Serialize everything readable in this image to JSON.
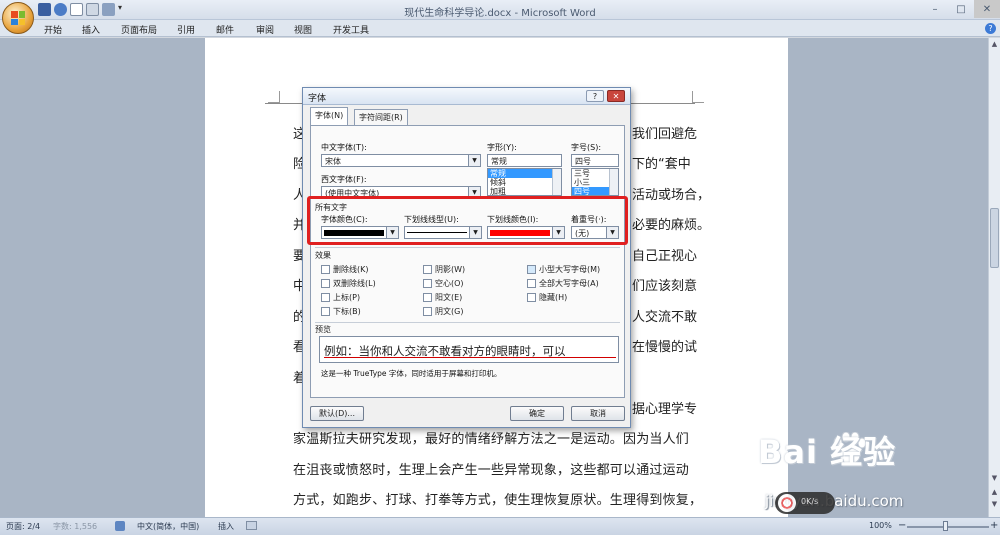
{
  "window": {
    "title": "现代生命科学导论.docx - Microsoft Word",
    "controls": [
      "–",
      "□",
      "✕"
    ]
  },
  "quick_access": {
    "items": [
      "save-icon",
      "undo-icon",
      "new-icon",
      "print-preview-icon",
      "repeat-icon"
    ],
    "customize_glyph": "▾"
  },
  "ribbon": {
    "tabs": [
      "开始",
      "插入",
      "页面布局",
      "引用",
      "邮件",
      "审阅",
      "视图",
      "开发工具"
    ],
    "help": "?"
  },
  "document": {
    "lines": [
      "这",
      "险",
      "人",
      "并",
      "要",
      "中",
      "的",
      "看",
      "着",
      "",
      "家温斯拉夫研究发现，最好的情绪纾解方法之一是运动。因为当人们",
      "在沮丧或愤怒时，生理上会产生一些异常现象，这些都可以通过运动",
      "方式，如跑步、打球、打拳等方式，使生理恢复原状。生理得到恢复，"
    ],
    "right_fragments": [
      "我们回避危",
      "下的“套中",
      "活动或场合，",
      "必要的麻烦。",
      "自己正视心",
      "们应该刻意",
      "人交流不敢",
      "在慢慢的试",
      "",
      "据心理学专"
    ]
  },
  "status": {
    "page": "页面: 2/4",
    "words": "字数: 1,556",
    "language": "中文(简体，中国)",
    "mode": "插入",
    "zoom": "100%",
    "zoom_minus": "−",
    "zoom_plus": "+"
  },
  "dialog": {
    "title": "字体",
    "help_btn": "?",
    "close_btn": "✕",
    "tabs": [
      "字体(N)",
      "字符间距(R)"
    ],
    "cn_font_label": "中文字体(T):",
    "cn_font_value": "宋体",
    "west_font_label": "西文字体(F):",
    "west_font_value": "(使用中文字体)",
    "style_label": "字形(Y):",
    "style_value": "常规",
    "style_options": [
      "常规",
      "倾斜",
      "加粗"
    ],
    "size_label": "字号(S):",
    "size_value": "四号",
    "size_options": [
      "三号",
      "小三",
      "四号"
    ],
    "all_text_label": "所有文字",
    "font_color_label": "字体颜色(C):",
    "underline_type_label": "下划线线型(U):",
    "underline_color_label": "下划线颜色(I):",
    "emphasis_label": "着重号(·):",
    "emphasis_value": "(无)",
    "font_color": "#000000",
    "underline_color": "#ff0000",
    "effects_label": "效果",
    "effects": {
      "col1": [
        "删除线(K)",
        "双删除线(L)",
        "上标(P)",
        "下标(B)"
      ],
      "col2": [
        "阴影(W)",
        "空心(O)",
        "阳文(E)",
        "阴文(G)"
      ],
      "col3": [
        "小型大写字母(M)",
        "全部大写字母(A)",
        "隐藏(H)"
      ]
    },
    "preview_label": "预览",
    "preview_text": "例如：当你和人交流不敢看对方的眼睛时，可以",
    "truetype_note": "这是一种 TrueType 字体，同时适用于屏幕和打印机。",
    "default_btn": "默认(D)...",
    "ok_btn": "确定",
    "cancel_btn": "取消"
  },
  "watermark": {
    "logo": "Bai 经验",
    "url": "jingyan.baidu.com",
    "speed": "0K/s"
  }
}
